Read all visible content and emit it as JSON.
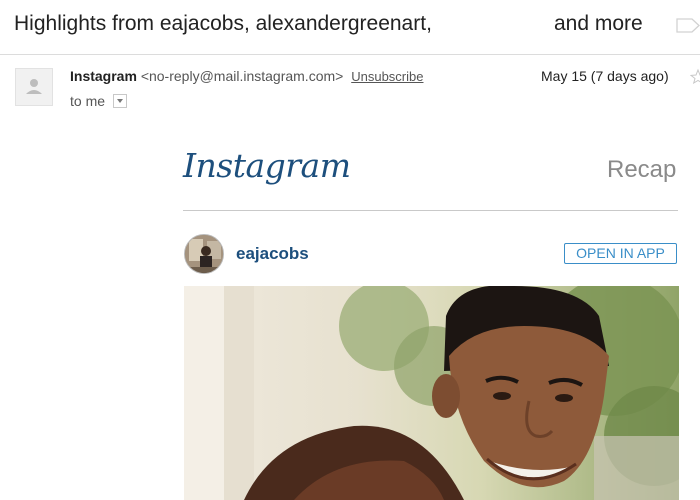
{
  "email": {
    "subject_left": "Highlights from eajacobs, alexandergreenart,",
    "subject_right": "and more",
    "sender_name": "Instagram",
    "sender_email": "<no-reply@mail.instagram.com>",
    "unsubscribe_label": "Unsubscribe",
    "date": "May 15 (7 days ago)",
    "to": "to me"
  },
  "instagram": {
    "logo": "Instagram",
    "recap": "Recap",
    "post": {
      "username": "eajacobs",
      "open_in_app_label": "OPEN IN APP"
    }
  },
  "icons": {
    "label": "label-icon",
    "star": "star-icon",
    "avatar": "person-icon",
    "dropdown": "chevron-down-icon"
  },
  "colors": {
    "instagram_blue": "#1d4f7d",
    "button_blue": "#3a8ec8",
    "recap_gray": "#8a8a8a"
  }
}
